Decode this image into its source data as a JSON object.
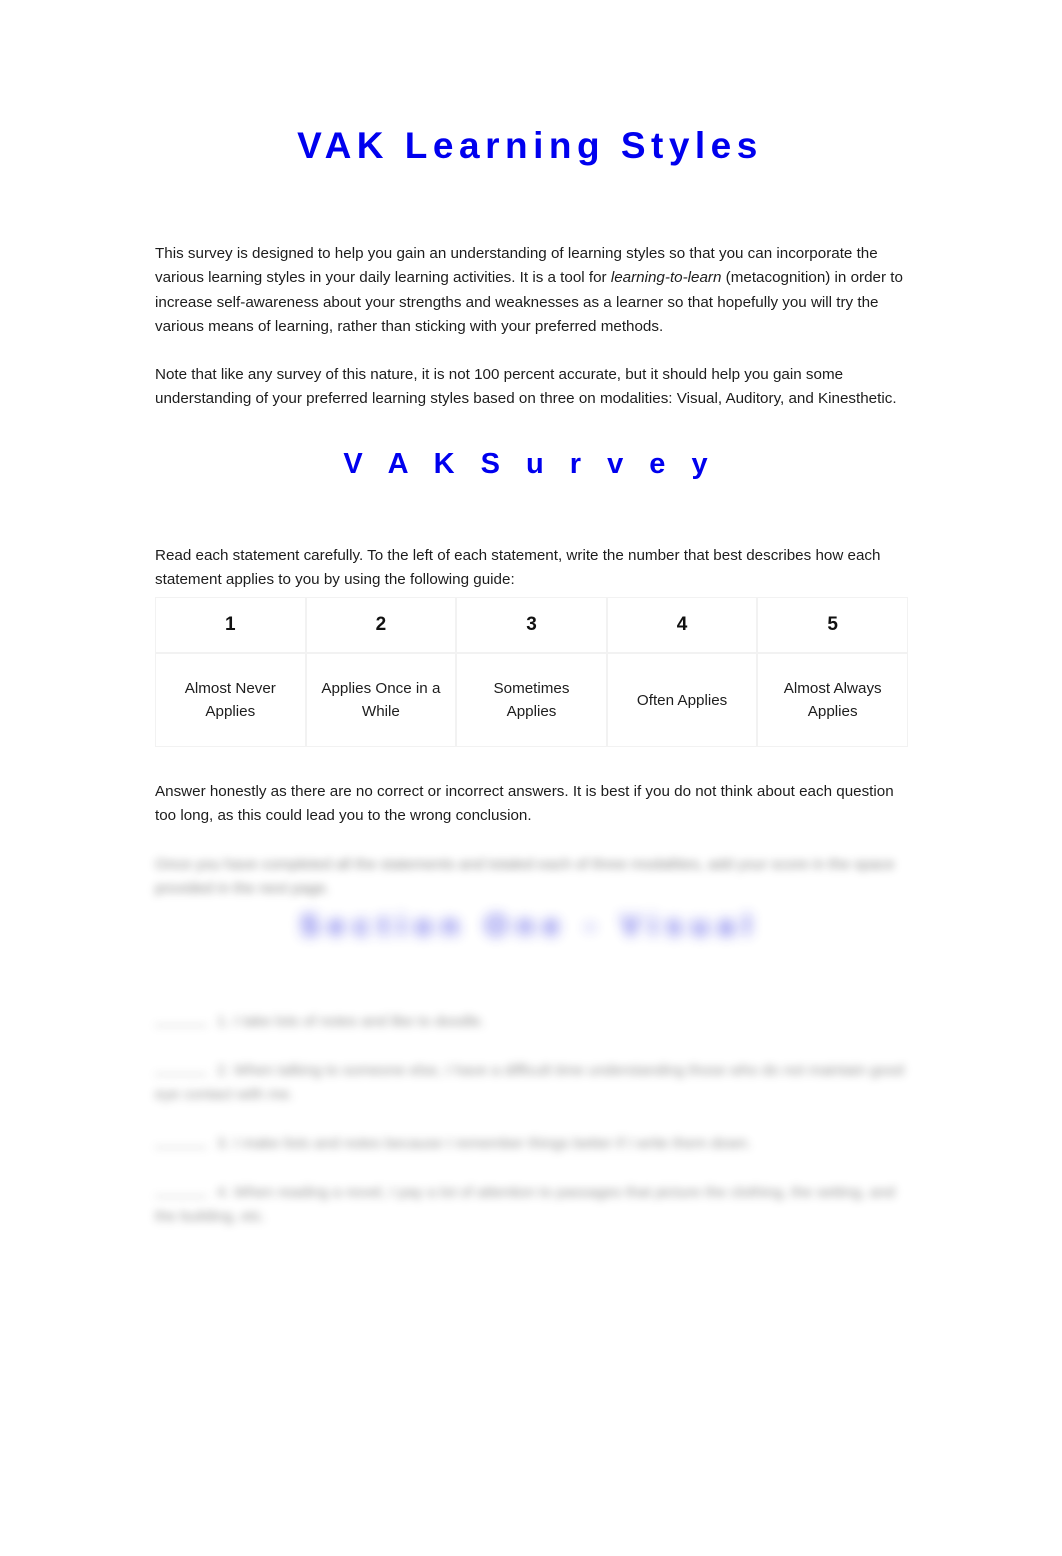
{
  "document": {
    "title": "VAK Learning Styles",
    "subtitle": "V A K S u r v e y",
    "paragraphs": {
      "intro_part1": "This survey is designed to help you gain an understanding of learning styles so that you can incorporate the various learning styles in your daily learning activities. It is a tool for ",
      "intro_italic": "learning-to-learn",
      "intro_part2": " (metacognition) in order to increase self-awareness about your strengths and weaknesses as a learner so that hopefully you will try the various means of learning, rather than sticking with your preferred methods.",
      "note": "Note that like any survey of this nature, it is not 100 percent accurate, but it should help you gain some understanding of your preferred learning styles based on three on modalities: Visual, Auditory, and Kinesthetic.",
      "read_instruction": "Read each statement carefully. To the left of each statement, write the number that best describes how each statement applies to you by using the following guide:",
      "answer_instruction": "Answer honestly as there are no correct or incorrect answers. It is best if you do not think about each question too long, as this could lead you to the wrong conclusion."
    },
    "scale_table": {
      "numbers": [
        "1",
        "2",
        "3",
        "4",
        "5"
      ],
      "labels": [
        "Almost Never Applies",
        "Applies Once in a While",
        "Sometimes Applies",
        "Often Applies",
        "Almost Always Applies"
      ]
    },
    "redacted": {
      "paragraph": "Once you have completed all the statements and totaled each of three modalities, add your score in the space provided in the next page.",
      "heading": "Section One - Visual",
      "items": [
        "1. I take lots of notes and like to doodle.",
        "2. When talking to someone else, I have a difficult time understanding those who do not maintain good eye contact with me.",
        "3. I make lists and notes because I remember things better if I write them down.",
        "4. When reading a novel, I pay a lot of attention to passages that picture the clothing, the setting, and the building, etc."
      ]
    }
  },
  "colors": {
    "heading_blue": "#0000EE",
    "body_text": "#1D1D1D",
    "table_border": "#F2F2F2",
    "page_background": "#FFFFFF"
  }
}
